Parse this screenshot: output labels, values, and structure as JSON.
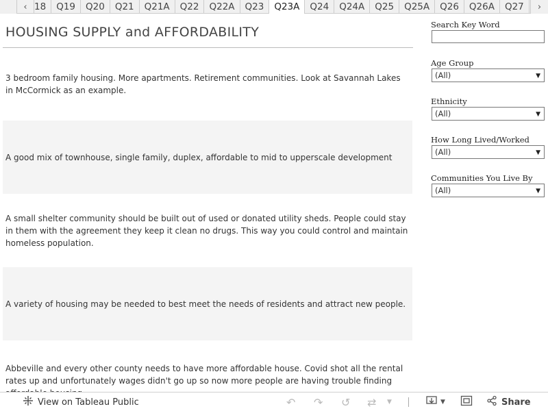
{
  "tabs": {
    "items": [
      "18",
      "Q19",
      "Q20",
      "Q21",
      "Q21A",
      "Q22",
      "Q22A",
      "Q23",
      "Q23A",
      "Q24",
      "Q24A",
      "Q25",
      "Q25A",
      "Q26",
      "Q26A",
      "Q27"
    ],
    "active": "Q23A",
    "prev_icon": "chevron-left-icon",
    "next_icon": "chevron-right-icon"
  },
  "title": "HOUSING SUPPLY and AFFORDABILITY",
  "responses": [
    "3 bedroom family housing. More apartments. Retirement communities. Look at Savannah Lakes in McCormick as an example.",
    "A good mix of townhouse, single family, duplex, affordable to mid to upperscale development",
    "A small shelter community should be built out of used or donated utility sheds. People could stay in them with the agreement they keep it clean no drugs. This way you could control and maintain homeless population.",
    "A variety of housing may be needed to best meet the needs of residents and attract new people.",
    "Abbeville and every other county needs to have more affordable house.  Covid shot all the rental rates up and unfortunately wages didn't go up so now more people are having trouble finding affordable housing."
  ],
  "filters": {
    "search": {
      "label": "Search Key Word",
      "value": ""
    },
    "age_group": {
      "label": "Age Group",
      "value": "(All)"
    },
    "ethnicity": {
      "label": "Ethnicity",
      "value": "(All)"
    },
    "how_long": {
      "label": "How Long Lived/Worked",
      "value": "(All)"
    },
    "communities": {
      "label": "Communities You Live By",
      "value": "(All)"
    }
  },
  "toolbar": {
    "view_on": "View on Tableau Public",
    "share": "Share",
    "icons": [
      "tableau-logo-icon",
      "undo-icon",
      "redo-icon",
      "revert-icon",
      "refresh-icon",
      "pause-dropdown-icon",
      "download-icon",
      "fullscreen-icon",
      "share-icon"
    ]
  }
}
